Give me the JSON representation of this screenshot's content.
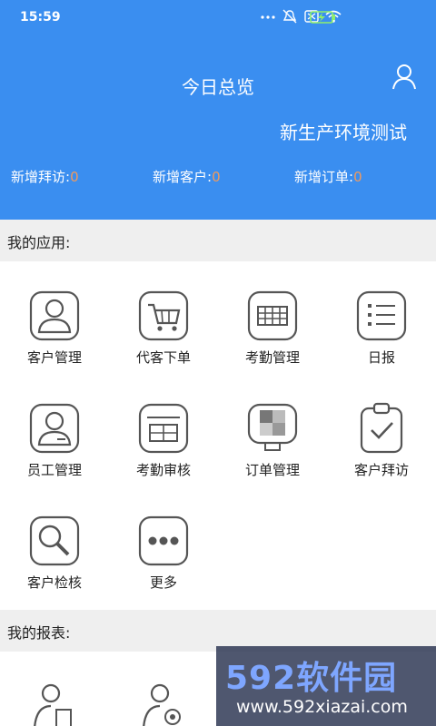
{
  "status": {
    "time": "15:59"
  },
  "header": {
    "title": "今日总览",
    "subtitle": "新生产环境测试",
    "stats": [
      {
        "label": "新增拜访:",
        "value": "0"
      },
      {
        "label": "新增客户:",
        "value": "0"
      },
      {
        "label": "新增订单:",
        "value": "0"
      }
    ]
  },
  "sections": {
    "apps_title": "我的应用:",
    "reports_title": "我的报表:"
  },
  "apps": [
    {
      "label": "客户管理",
      "icon": "customer-icon"
    },
    {
      "label": "代客下单",
      "icon": "cart-icon"
    },
    {
      "label": "考勤管理",
      "icon": "attendance-grid-icon"
    },
    {
      "label": "日报",
      "icon": "daily-report-icon"
    },
    {
      "label": "员工管理",
      "icon": "employee-icon"
    },
    {
      "label": "考勤审核",
      "icon": "calendar-icon"
    },
    {
      "label": "订单管理",
      "icon": "order-icon"
    },
    {
      "label": "客户拜访",
      "icon": "clipboard-check-icon"
    },
    {
      "label": "客户检核",
      "icon": "magnifier-icon"
    },
    {
      "label": "更多",
      "icon": "more-icon"
    }
  ],
  "watermark": {
    "big": "592软件园",
    "small": "www.592xiazai.com"
  },
  "colors": {
    "header": "#3a8ef0",
    "stat_value": "#f19a5c"
  }
}
